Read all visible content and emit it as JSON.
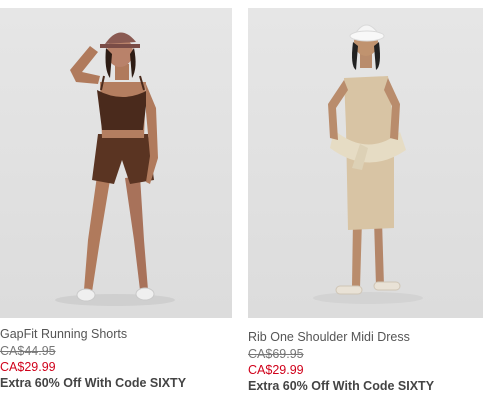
{
  "products": [
    {
      "name": "GapFit Running Shorts",
      "original_price": "CA$44.95",
      "sale_price": "CA$29.99",
      "promo": "Extra 60% Off With Code SIXTY",
      "image": "model-brown-tank-running-shorts"
    },
    {
      "name": "Rib One Shoulder Midi Dress",
      "original_price": "CA$69.95",
      "sale_price": "CA$29.99",
      "promo": "Extra 60% Off With Code SIXTY",
      "image": "model-beige-midi-dress-bucket-hat"
    }
  ],
  "colors": {
    "sale_price": "#d0021b",
    "product_name": "#555555",
    "original_price": "#777777",
    "promo": "#444444",
    "image_background": "#e0e0e0"
  }
}
